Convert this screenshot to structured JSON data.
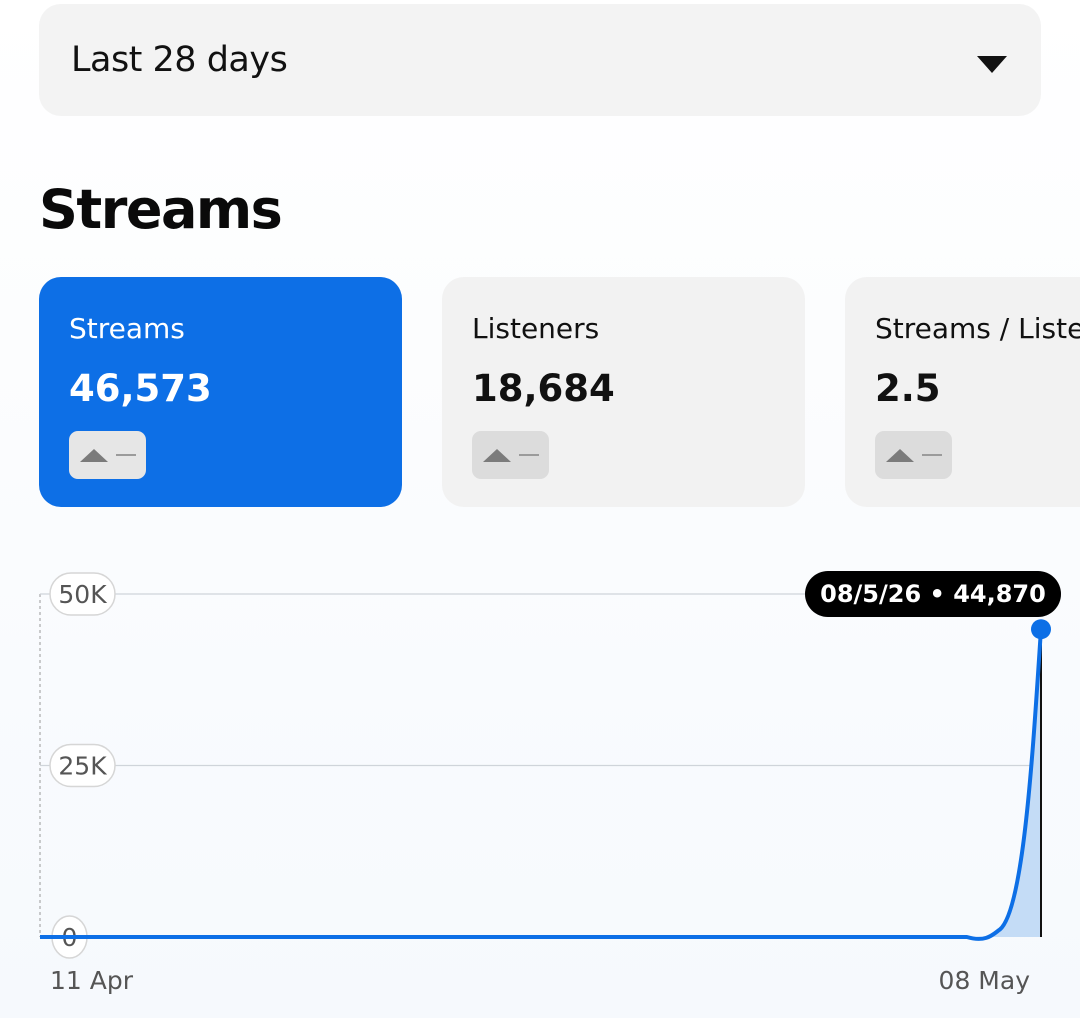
{
  "filter": {
    "selected": "Last 28 days"
  },
  "section": {
    "title": "Streams"
  },
  "metrics": [
    {
      "label": "Streams",
      "value": "46,573",
      "active": true
    },
    {
      "label": "Listeners",
      "value": "18,684",
      "active": false
    },
    {
      "label": "Streams / Listener",
      "value": "2.5",
      "active": false
    }
  ],
  "colors": {
    "accent": "#0d6fe6",
    "card_bg": "#f2f2f2",
    "tooltip_bg": "#000000"
  },
  "chart_data": {
    "type": "area",
    "x_ticks": [
      "11 Apr",
      "08 May"
    ],
    "y_ticks": [
      "0",
      "25K",
      "50K"
    ],
    "ylim": [
      0,
      50000
    ],
    "x": [
      "11 Apr",
      "12 Apr",
      "13 Apr",
      "14 Apr",
      "15 Apr",
      "16 Apr",
      "17 Apr",
      "18 Apr",
      "19 Apr",
      "20 Apr",
      "21 Apr",
      "22 Apr",
      "23 Apr",
      "24 Apr",
      "25 Apr",
      "26 Apr",
      "27 Apr",
      "28 Apr",
      "29 Apr",
      "30 Apr",
      "01 May",
      "02 May",
      "03 May",
      "04 May",
      "05 May",
      "06 May",
      "07 May",
      "08 May"
    ],
    "series": [
      {
        "values": [
          0,
          0,
          0,
          0,
          0,
          0,
          0,
          0,
          0,
          0,
          0,
          0,
          0,
          0,
          0,
          0,
          0,
          0,
          0,
          0,
          0,
          0,
          0,
          0,
          0,
          0,
          1100,
          44870
        ]
      }
    ],
    "highlight": {
      "date": "08/5/26",
      "value": "44,870",
      "label": "08/5/26 • 44,870"
    }
  }
}
